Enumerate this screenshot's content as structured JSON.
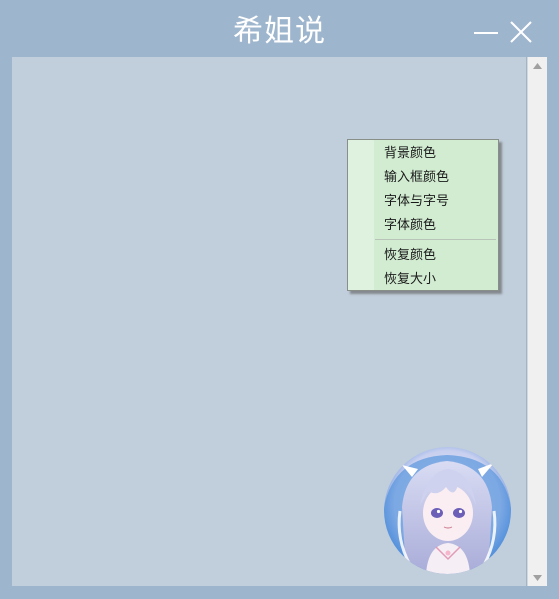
{
  "window": {
    "title": "希姐说",
    "background_color": "#9db5cd",
    "content_color": "#c1cedb"
  },
  "controls": {
    "minimize_icon": "minimize-icon",
    "close_icon": "close-icon"
  },
  "context_menu": {
    "background_color": "#d2ecd2",
    "items": [
      {
        "label": "背景颜色"
      },
      {
        "label": "输入框颜色"
      },
      {
        "label": "字体与字号"
      },
      {
        "label": "字体颜色"
      },
      {
        "label": "恢复颜色"
      },
      {
        "label": "恢复大小"
      }
    ]
  },
  "avatar": {
    "icon": "anime-girl-avatar"
  }
}
